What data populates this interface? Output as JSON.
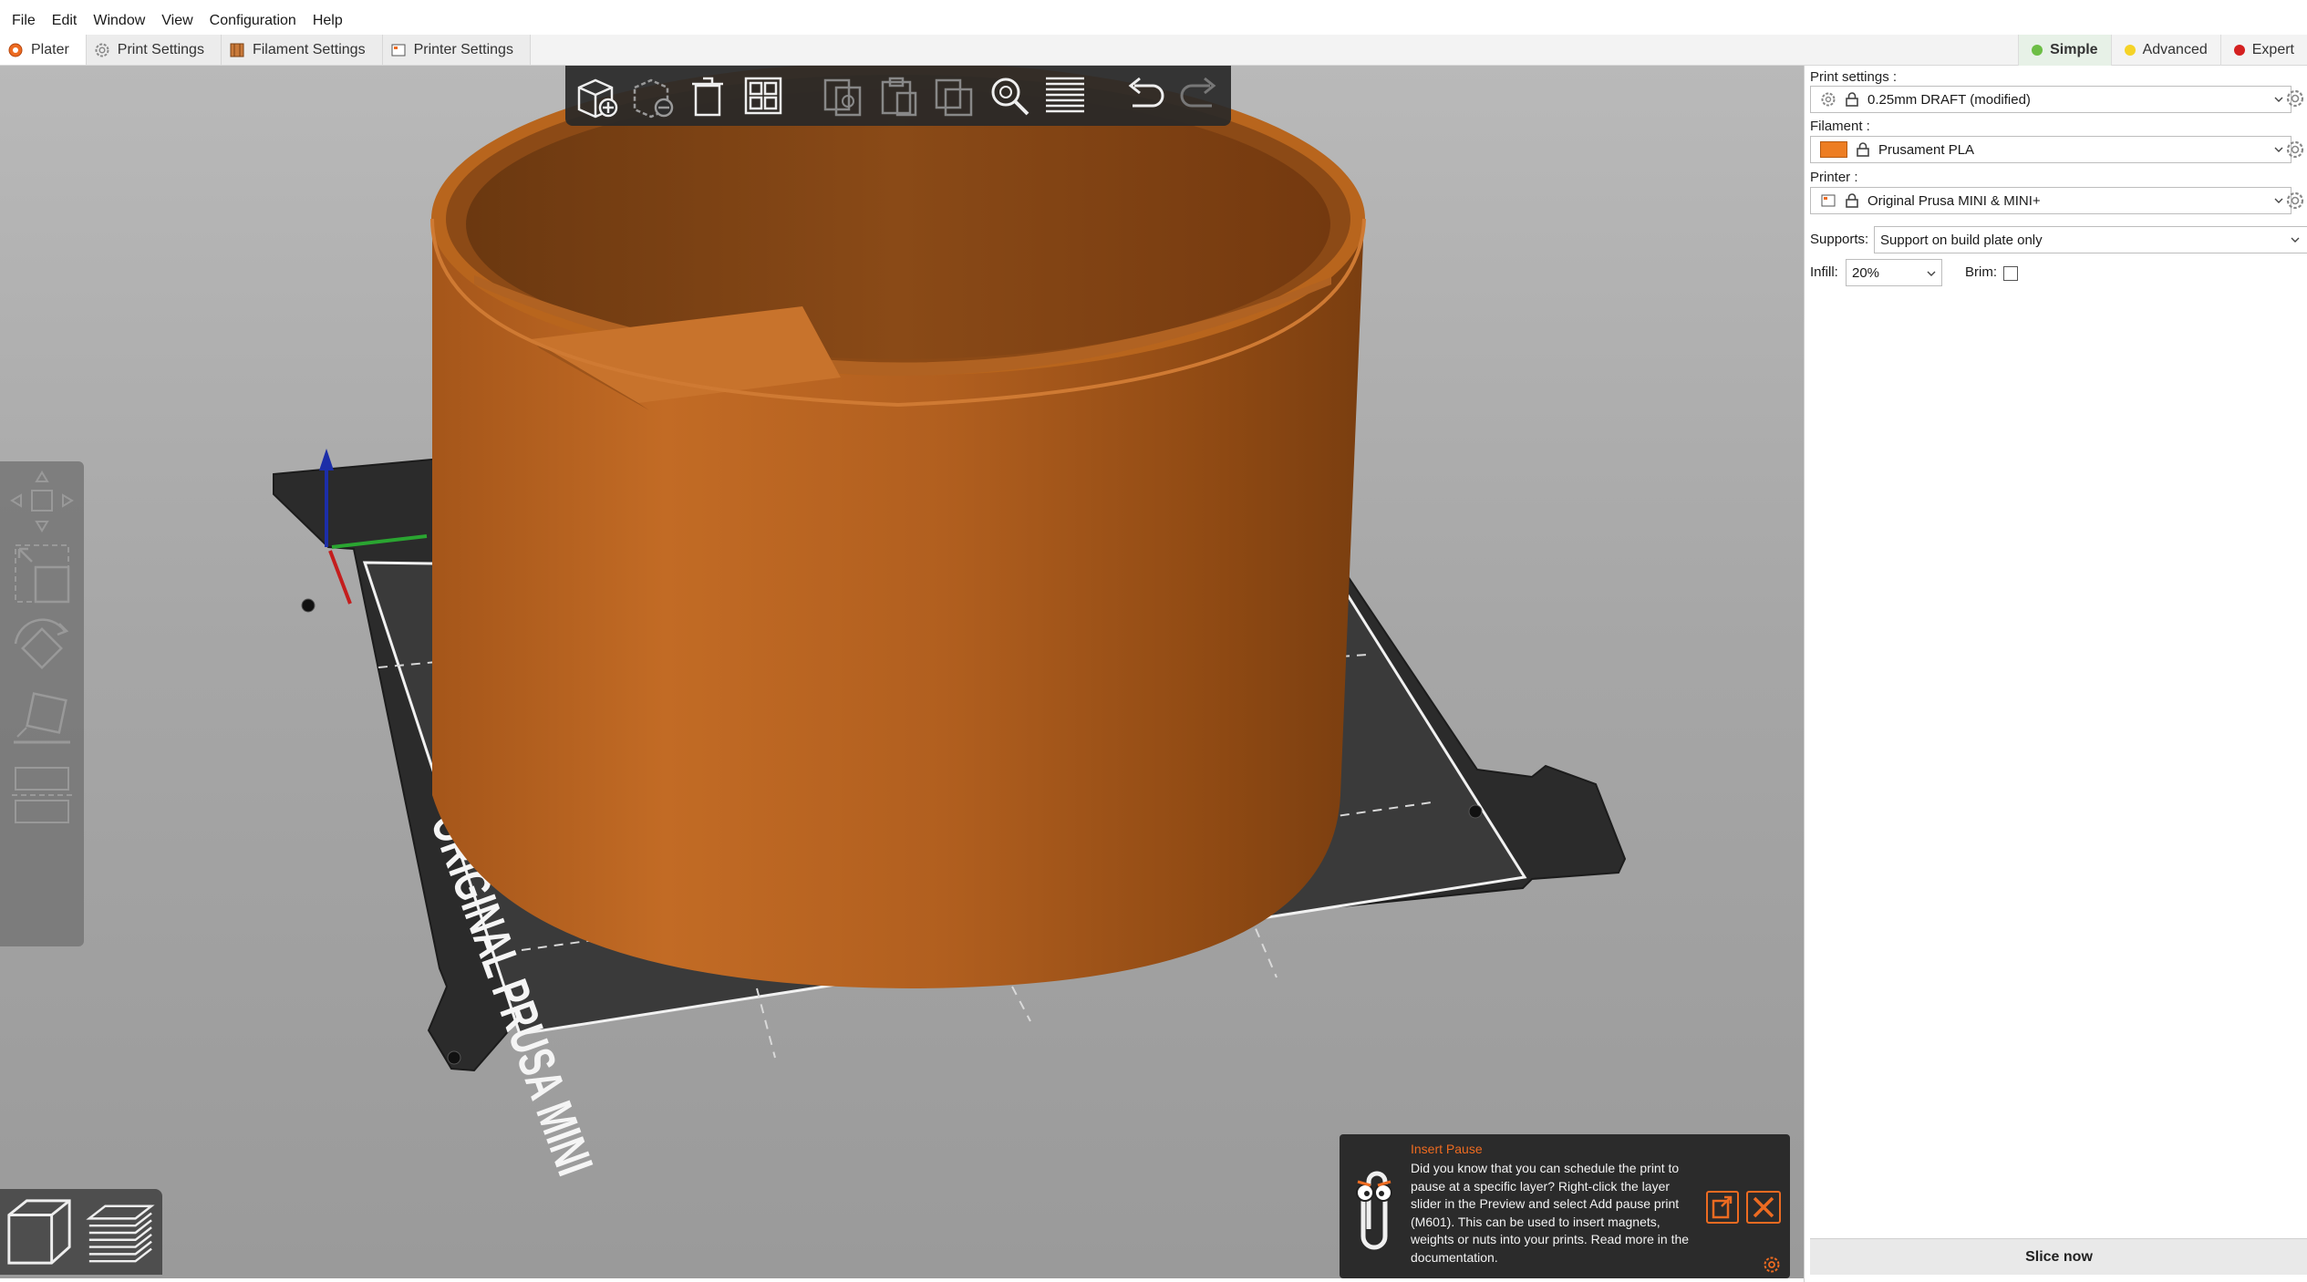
{
  "menu": [
    "File",
    "Edit",
    "Window",
    "View",
    "Configuration",
    "Help"
  ],
  "tabs": [
    {
      "label": "Plater",
      "icon": "plater-icon"
    },
    {
      "label": "Print Settings",
      "icon": "gear-icon"
    },
    {
      "label": "Filament Settings",
      "icon": "spool-icon"
    },
    {
      "label": "Printer Settings",
      "icon": "printer-icon"
    }
  ],
  "modes": [
    {
      "label": "Simple",
      "color": "#6cbe45"
    },
    {
      "label": "Advanced",
      "color": "#f5d327"
    },
    {
      "label": "Expert",
      "color": "#d42020"
    }
  ],
  "sidebar": {
    "print_settings_label": "Print settings :",
    "print_settings_value": "0.25mm DRAFT (modified)",
    "filament_label": "Filament :",
    "filament_value": "Prusament PLA",
    "filament_color": "#ed7d22",
    "printer_label": "Printer :",
    "printer_value": "Original Prusa MINI & MINI+",
    "supports_label": "Supports:",
    "supports_value": "Support on build plate only",
    "infill_label": "Infill:",
    "infill_value": "20%",
    "brim_label": "Brim:",
    "slice_button": "Slice now"
  },
  "bed": {
    "label": "ORIGINAL PRUSA MINI"
  },
  "hint": {
    "title": "Insert Pause",
    "body": "Did you know that you can schedule the print to pause at a specific layer? Right-click the layer slider in the Preview and select Add pause print (M601). This can be used to insert magnets, weights or nuts into your prints. Read more in the documentation."
  },
  "toolbar_icons": [
    "add-icon",
    "delete-icon",
    "delete-all-icon",
    "arrange-icon",
    "copy-icon",
    "paste-icon",
    "instances-icon",
    "search-icon",
    "layers-icon",
    "undo-icon",
    "redo-icon"
  ],
  "colors": {
    "accent": "#ed6b21",
    "model": "#b8651d",
    "bed": "#2b2b2b"
  }
}
